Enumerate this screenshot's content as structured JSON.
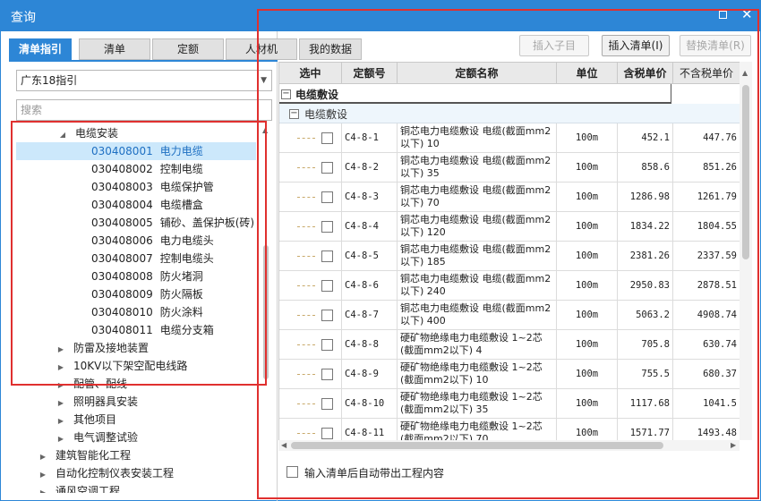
{
  "window": {
    "title": "查询",
    "maximize_icon": "maximize-icon",
    "close_icon": "close-icon",
    "close_glyph": "✕"
  },
  "tabs": [
    {
      "label": "清单指引",
      "active": true
    },
    {
      "label": "清单",
      "active": false
    },
    {
      "label": "定额",
      "active": false
    },
    {
      "label": "人材机",
      "active": false
    },
    {
      "label": "我的数据",
      "active": false
    }
  ],
  "left": {
    "guide_select": "广东18指引",
    "search_placeholder": "搜索",
    "tree": [
      {
        "level": 2,
        "expanded": true,
        "name": "电缆安装"
      },
      {
        "level": 3,
        "code": "030408001",
        "name": "电力电缆",
        "selected": true
      },
      {
        "level": 3,
        "code": "030408002",
        "name": "控制电缆"
      },
      {
        "level": 3,
        "code": "030408003",
        "name": "电缆保护管"
      },
      {
        "level": 3,
        "code": "030408004",
        "name": "电缆槽盒"
      },
      {
        "level": 3,
        "code": "030408005",
        "name": "铺砂、盖保护板(砖)"
      },
      {
        "level": 3,
        "code": "030408006",
        "name": "电力电缆头"
      },
      {
        "level": 3,
        "code": "030408007",
        "name": "控制电缆头"
      },
      {
        "level": 3,
        "code": "030408008",
        "name": "防火堵洞"
      },
      {
        "level": 3,
        "code": "030408009",
        "name": "防火隔板"
      },
      {
        "level": 3,
        "code": "030408010",
        "name": "防火涂料"
      },
      {
        "level": 3,
        "code": "030408011",
        "name": "电缆分支箱"
      },
      {
        "level": 2,
        "expanded": false,
        "name": "防雷及接地装置"
      },
      {
        "level": 2,
        "expanded": false,
        "name": "10KV以下架空配电线路"
      },
      {
        "level": 2,
        "expanded": false,
        "name": "配管、配线"
      },
      {
        "level": 2,
        "expanded": false,
        "name": "照明器具安装"
      },
      {
        "level": 2,
        "expanded": false,
        "name": "其他项目"
      },
      {
        "level": 2,
        "expanded": false,
        "name": "电气调整试验"
      },
      {
        "level": 1,
        "expanded": false,
        "name": "建筑智能化工程"
      },
      {
        "level": 1,
        "expanded": false,
        "name": "自动化控制仪表安装工程"
      },
      {
        "level": 1,
        "expanded": false,
        "name": "通风空调工程"
      }
    ]
  },
  "toolbar": {
    "insert_child": "插入子目",
    "insert_list": "插入清单(I)",
    "replace_list": "替换清单(R)"
  },
  "grid": {
    "headers": [
      "选中",
      "定额号",
      "定额名称",
      "单位",
      "含税单价",
      "不含税单价"
    ],
    "group1": "电缆敷设",
    "group2": "电缆敷设",
    "rows": [
      {
        "code": "C4-8-1",
        "name": "铜芯电力电缆敷设 电缆(截面mm2以下) 10",
        "unit": "100m",
        "price_tax": "452.1",
        "price_notax": "447.76"
      },
      {
        "code": "C4-8-2",
        "name": "铜芯电力电缆敷设 电缆(截面mm2以下) 35",
        "unit": "100m",
        "price_tax": "858.6",
        "price_notax": "851.26"
      },
      {
        "code": "C4-8-3",
        "name": "铜芯电力电缆敷设 电缆(截面mm2以下) 70",
        "unit": "100m",
        "price_tax": "1286.98",
        "price_notax": "1261.79"
      },
      {
        "code": "C4-8-4",
        "name": "铜芯电力电缆敷设 电缆(截面mm2以下) 120",
        "unit": "100m",
        "price_tax": "1834.22",
        "price_notax": "1804.55"
      },
      {
        "code": "C4-8-5",
        "name": "铜芯电力电缆敷设 电缆(截面mm2以下) 185",
        "unit": "100m",
        "price_tax": "2381.26",
        "price_notax": "2337.59"
      },
      {
        "code": "C4-8-6",
        "name": "铜芯电力电缆敷设 电缆(截面mm2以下) 240",
        "unit": "100m",
        "price_tax": "2950.83",
        "price_notax": "2878.51"
      },
      {
        "code": "C4-8-7",
        "name": "铜芯电力电缆敷设 电缆(截面mm2以下) 400",
        "unit": "100m",
        "price_tax": "5063.2",
        "price_notax": "4908.74"
      },
      {
        "code": "C4-8-8",
        "name": "硬矿物绝缘电力电缆敷设 1~2芯(截面mm2以下) 4",
        "unit": "100m",
        "price_tax": "705.8",
        "price_notax": "630.74"
      },
      {
        "code": "C4-8-9",
        "name": "硬矿物绝缘电力电缆敷设 1~2芯(截面mm2以下) 10",
        "unit": "100m",
        "price_tax": "755.5",
        "price_notax": "680.37"
      },
      {
        "code": "C4-8-10",
        "name": "硬矿物绝缘电力电缆敷设 1~2芯(截面mm2以下) 35",
        "unit": "100m",
        "price_tax": "1117.68",
        "price_notax": "1041.5"
      },
      {
        "code": "C4-8-11",
        "name": "硬矿物绝缘电力电缆敷设 1~2芯(截面mm2以下) 70",
        "unit": "100m",
        "price_tax": "1571.77",
        "price_notax": "1493.48"
      }
    ]
  },
  "footer": {
    "auto_bring_label": "输入清单后自动带出工程内容"
  },
  "colors": {
    "accent": "#2d86d6",
    "selected_row": "#cce8fb",
    "highlight_box": "#e0302f"
  }
}
